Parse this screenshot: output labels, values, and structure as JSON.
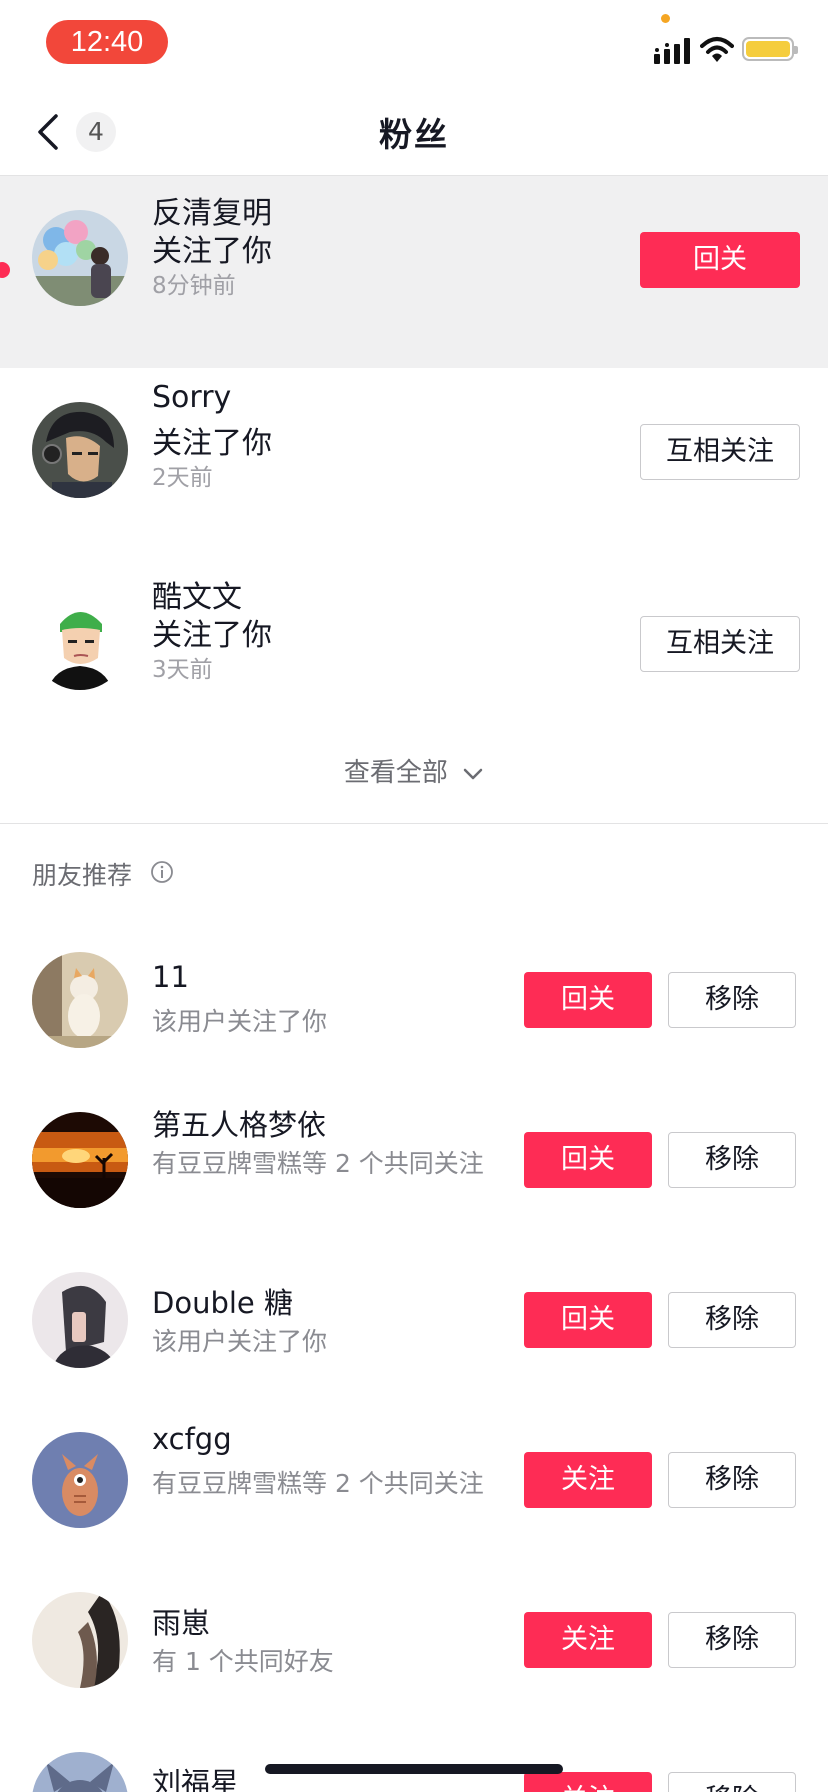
{
  "status_bar": {
    "time": "12:40"
  },
  "nav": {
    "back_icon": "chevron-left-icon",
    "badge_count": "4",
    "title": "粉丝"
  },
  "followers": [
    {
      "name": "反清复明",
      "action": "关注了你",
      "time": "8分钟前",
      "button": "回关",
      "button_style": "red",
      "unread": true,
      "highlight": true
    },
    {
      "name": "Sorry",
      "action": "关注了你",
      "time": "2天前",
      "button": "互相关注",
      "button_style": "outline",
      "unread": false,
      "highlight": false
    },
    {
      "name": "酷文文",
      "action": "关注了你",
      "time": "3天前",
      "button": "互相关注",
      "button_style": "outline",
      "unread": false,
      "highlight": false
    }
  ],
  "view_all": {
    "label": "查看全部"
  },
  "recommend": {
    "title": "朋友推荐",
    "items": [
      {
        "name": "11",
        "subtitle": "该用户关注了你",
        "primary": "回关",
        "secondary": "移除"
      },
      {
        "name": "第五人格梦依",
        "subtitle": "有豆豆牌雪糕等 2 个共同关注",
        "primary": "回关",
        "secondary": "移除"
      },
      {
        "name": "Double 糖",
        "subtitle": "该用户关注了你",
        "primary": "回关",
        "secondary": "移除"
      },
      {
        "name": "xcfgg",
        "subtitle": "有豆豆牌雪糕等 2 个共同关注",
        "primary": "关注",
        "secondary": "移除"
      },
      {
        "name": "雨崽",
        "subtitle": "有 1 个共同好友",
        "primary": "关注",
        "secondary": "移除"
      },
      {
        "name": "刘福星",
        "subtitle": "",
        "primary": "关注",
        "secondary": "移除"
      }
    ]
  },
  "colors": {
    "accent": "#fe2c55",
    "status_pill": "#f2473a",
    "battery": "#f5cd3d"
  }
}
